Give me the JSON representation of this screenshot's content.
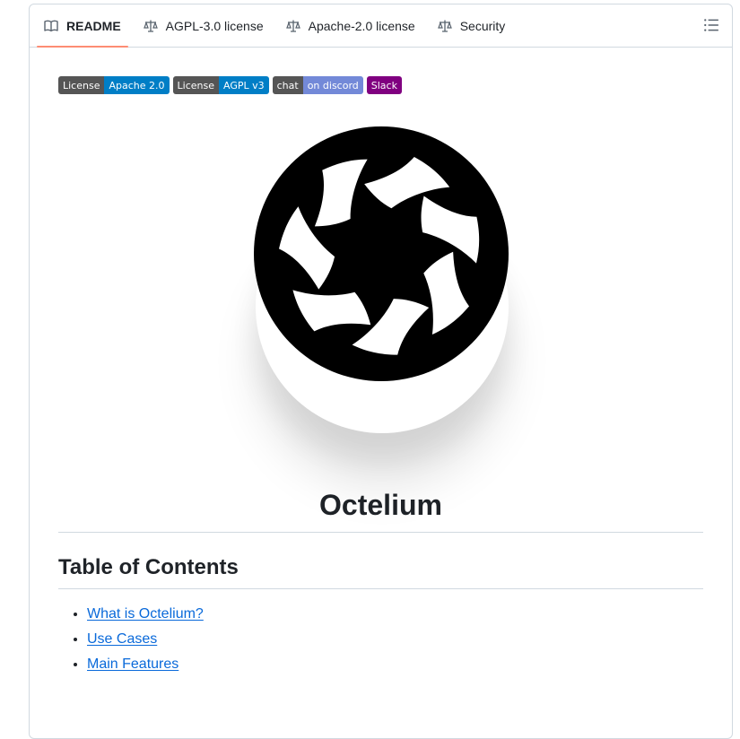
{
  "tabs": [
    {
      "label": "README",
      "icon": "book-icon",
      "active": true
    },
    {
      "label": "AGPL-3.0 license",
      "icon": "law-icon",
      "active": false
    },
    {
      "label": "Apache-2.0 license",
      "icon": "law-icon",
      "active": false
    },
    {
      "label": "Security",
      "icon": "law-icon",
      "active": false
    }
  ],
  "outline_icon": "list-unordered-icon",
  "badges": [
    {
      "left": "License",
      "right": "Apache 2.0",
      "color": "#007ec6"
    },
    {
      "left": "License",
      "right": "AGPL v3",
      "color": "#007ec6"
    },
    {
      "left": "chat",
      "right": "on discord",
      "color": "#7389d8"
    },
    {
      "left": "",
      "right": "Slack",
      "color": "#800080"
    }
  ],
  "readme": {
    "title": "Octelium",
    "toc_heading": "Table of Contents",
    "toc": [
      "What is Octelium?",
      "Use Cases",
      "Main Features"
    ]
  },
  "colors": {
    "link": "#0969da",
    "active_tab_underline": "#fd8c73",
    "border": "#d1d9e0"
  }
}
